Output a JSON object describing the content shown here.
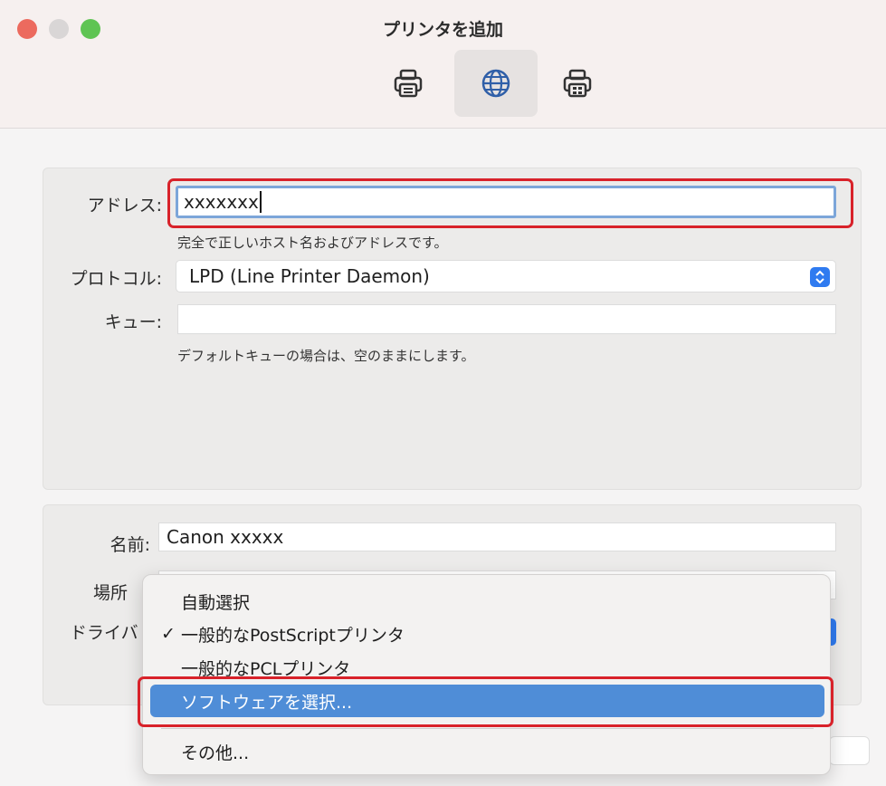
{
  "window": {
    "title": "プリンタを追加",
    "toolbar": [
      {
        "name": "default-printer",
        "icon": "printer-icon",
        "selected": false
      },
      {
        "name": "ip-printer",
        "icon": "globe-icon",
        "selected": true
      },
      {
        "name": "windows-printer",
        "icon": "printer-windows-icon",
        "selected": false
      }
    ]
  },
  "address": {
    "label": "アドレス:",
    "value": "xxxxxxx",
    "hint": "完全で正しいホスト名およびアドレスです。"
  },
  "protocol": {
    "label": "プロトコル:",
    "value": "LPD (Line Printer Daemon)"
  },
  "queue": {
    "label": "キュー:",
    "value": "",
    "hint": "デフォルトキューの場合は、空のままにします。"
  },
  "name": {
    "label": "名前:",
    "value": "Canon xxxxx"
  },
  "location": {
    "label": "場所"
  },
  "driver": {
    "label": "ドライバ"
  },
  "driver_menu": {
    "items": [
      {
        "label": "自動選択",
        "checked": false
      },
      {
        "label": "一般的なPostScriptプリンタ",
        "checked": true
      },
      {
        "label": "一般的なPCLプリンタ",
        "checked": false
      },
      {
        "label": "ソフトウェアを選択...",
        "checked": false,
        "highlighted": true
      },
      {
        "label": "その他...",
        "checked": false
      }
    ],
    "check_mark": "✓"
  },
  "colors": {
    "highlight": "#4f8dd7",
    "annotation": "#d8222a",
    "accent": "#2f7bf0"
  }
}
